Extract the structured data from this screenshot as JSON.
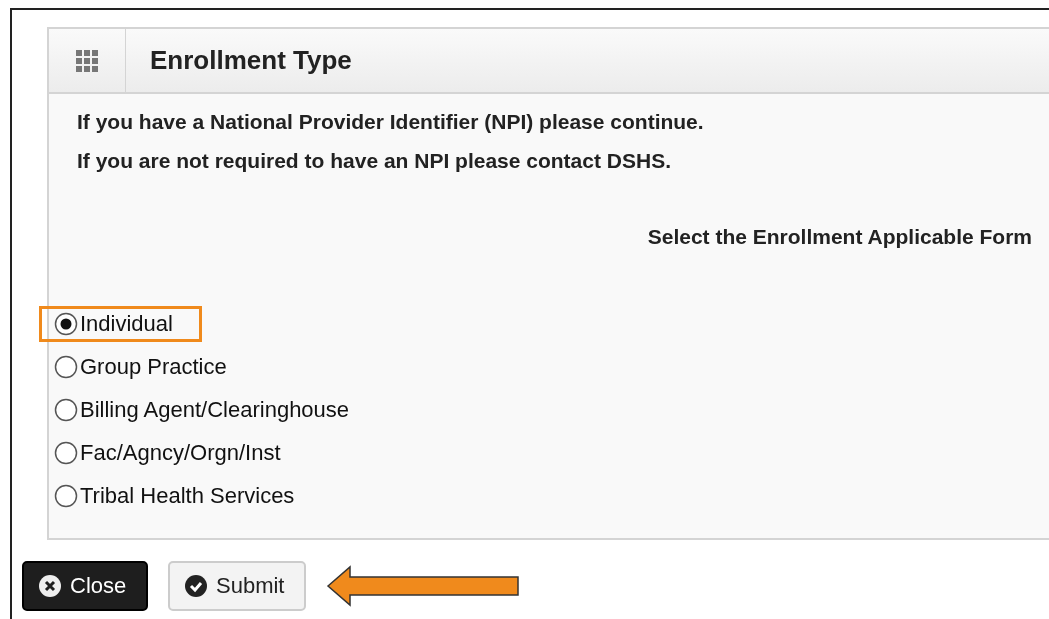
{
  "panel": {
    "title": "Enrollment Type",
    "notes": [
      "If you have a National Provider Identifier (NPI) please continue.",
      "If you are not required to have an NPI please contact DSHS."
    ],
    "prompt": "Select the Enrollment Applicable Form",
    "options": [
      {
        "label": "Individual",
        "selected": true,
        "highlighted": true
      },
      {
        "label": "Group Practice",
        "selected": false,
        "highlighted": false
      },
      {
        "label": "Billing Agent/Clearinghouse",
        "selected": false,
        "highlighted": false
      },
      {
        "label": "Fac/Agncy/Orgn/Inst",
        "selected": false,
        "highlighted": false
      },
      {
        "label": "Tribal Health Services",
        "selected": false,
        "highlighted": false
      }
    ]
  },
  "buttons": [
    {
      "label": "Close",
      "kind": "close"
    },
    {
      "label": "Submit",
      "kind": "submit"
    }
  ],
  "annotations": [
    {
      "kind": "arrow"
    }
  ]
}
